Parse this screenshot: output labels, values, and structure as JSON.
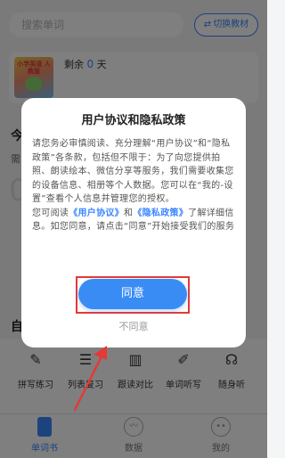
{
  "search": {
    "placeholder": "搜索单词"
  },
  "switch_button": {
    "label": "切换教材"
  },
  "book": {
    "cover_title": "小学英语 人教版",
    "remain_prefix": "剩余",
    "remain_count": "0",
    "remain_unit": "天"
  },
  "fragments": {
    "today": "今",
    "need": "需",
    "zero": "0",
    "self": "自"
  },
  "tools": [
    {
      "label": "拼写练习",
      "icon": "pen-icon"
    },
    {
      "label": "列表复习",
      "icon": "list-icon"
    },
    {
      "label": "跟读对比",
      "icon": "waveform-icon"
    },
    {
      "label": "单词听写",
      "icon": "edit-icon"
    },
    {
      "label": "随身听",
      "icon": "headphones-icon"
    }
  ],
  "tabbar": [
    {
      "label": "单词书",
      "icon": "book-icon",
      "active": true
    },
    {
      "label": "数据",
      "icon": "chart-icon",
      "active": false
    },
    {
      "label": "我的",
      "icon": "user-icon",
      "active": false
    }
  ],
  "dialog": {
    "title": "用户协议和隐私政策",
    "para1": "请您务必审慎阅读、充分理解“用户协议”和“隐私政策”各条款，包括但不限于：为了向您提供拍照、朗读绘本、微信分享等服务，我们需要收集您的设备信息、相册等个人数据。您可以在“我的-设置”查看个人信息并管理您的授权。",
    "para2_prefix": "您可阅读",
    "link_agreement": "《用户协议》",
    "para2_and": "和",
    "link_privacy": "《隐私政策》",
    "para2_suffix": "了解详细信息。如您同意，请点击“同意”开始接受我们的服务",
    "agree_label": "同意",
    "disagree_label": "不同意"
  },
  "colors": {
    "accent": "#3a86ff",
    "highlight": "#e53935",
    "overlay": "rgba(0,0,0,0.5)"
  }
}
